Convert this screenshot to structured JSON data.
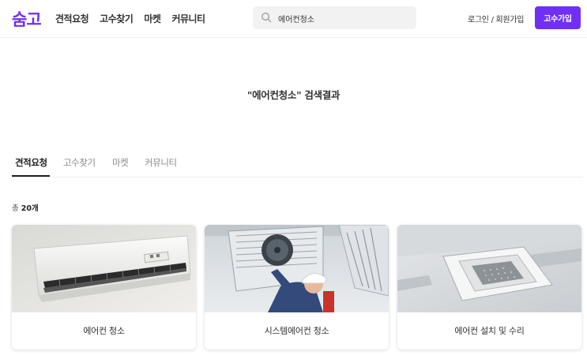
{
  "header": {
    "logo": "숨고",
    "nav": [
      "견적요청",
      "고수찾기",
      "마켓",
      "커뮤니티"
    ],
    "search_value": "에어컨청소",
    "login_label": "로그인 / 회원가입",
    "join_label": "고수가입"
  },
  "main": {
    "result_title": "\"에어컨청소\" 검색결과",
    "tabs": [
      "견적요청",
      "고수찾기",
      "마켓",
      "커뮤니티"
    ],
    "active_tab": "견적요청",
    "count_prefix": "총 ",
    "count_value": "20개"
  },
  "cards": [
    {
      "label": "에어컨 청소",
      "image": "wall-air-conditioner"
    },
    {
      "label": "시스템에어컨 청소",
      "image": "technician-cleaning-ceiling-ac"
    },
    {
      "label": "에어컨 설치 및 수리",
      "image": "ceiling-cassette-ac"
    }
  ],
  "colors": {
    "brand": "#6f2ff5"
  }
}
